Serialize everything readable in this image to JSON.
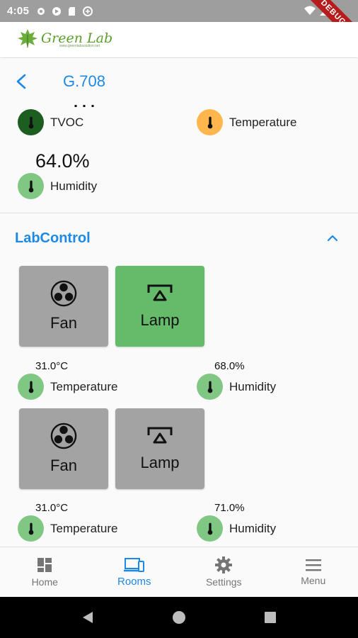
{
  "status_bar": {
    "time": "4:05",
    "debug_label": "DEBUG"
  },
  "logo": {
    "name": "Green Lab",
    "subtext": "www.greenlabsolution.net"
  },
  "app_bar": {
    "title": "G.708"
  },
  "top_sensors": {
    "tvoc_label": "TVOC",
    "temperature_label": "Temperature",
    "humidity_value": "64.0%",
    "humidity_label": "Humidity"
  },
  "section": {
    "title": "LabControl"
  },
  "groups": [
    {
      "controls": [
        {
          "label": "Fan",
          "state": "off",
          "icon": "fan-icon"
        },
        {
          "label": "Lamp",
          "state": "on",
          "icon": "lamp-icon"
        }
      ],
      "temperature": {
        "value": "31.0°C",
        "label": "Temperature"
      },
      "humidity": {
        "value": "68.0%",
        "label": "Humidity"
      }
    },
    {
      "controls": [
        {
          "label": "Fan",
          "state": "off",
          "icon": "fan-icon"
        },
        {
          "label": "Lamp",
          "state": "off",
          "icon": "lamp-icon"
        }
      ],
      "temperature": {
        "value": "31.0°C",
        "label": "Temperature"
      },
      "humidity": {
        "value": "71.0%",
        "label": "Humidity"
      }
    }
  ],
  "bottom_nav": [
    {
      "label": "Home",
      "icon": "dashboard-icon",
      "active": false
    },
    {
      "label": "Rooms",
      "icon": "devices-icon",
      "active": true
    },
    {
      "label": "Settings",
      "icon": "gear-icon",
      "active": false
    },
    {
      "label": "Menu",
      "icon": "hamburger-icon",
      "active": false
    }
  ],
  "colors": {
    "accent": "#1e88e5",
    "on": "#66bb6a",
    "off": "#a3a3a3",
    "brand": "#5a9e2c"
  }
}
